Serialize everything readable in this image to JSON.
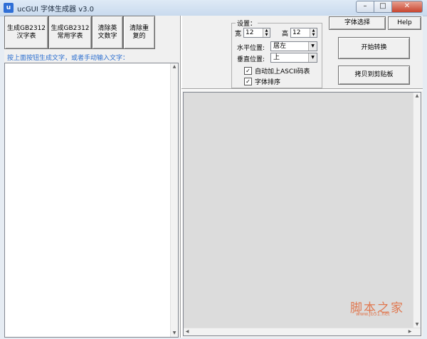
{
  "window": {
    "title": "ucGUI 字体生成器 v3.0",
    "icon": "app-icon",
    "controls": {
      "minimize": "–",
      "maximize": "□",
      "close": "✕"
    }
  },
  "left_panel": {
    "buttons": [
      "生成GB2312\n汉字表",
      "生成GB2312\n常用字表",
      "清除英\n文数字",
      "清除重\n复的"
    ],
    "hint": "按上面按钮生成文字，或者手动输入文字："
  },
  "settings": {
    "group_title": "设置：",
    "width_label": "宽",
    "width_value": "12",
    "height_label": "高",
    "height_value": "12",
    "h_align_label": "水平位置:",
    "h_align_value": "居左",
    "v_align_label": "垂直位置:",
    "v_align_value": "上",
    "auto_ascii_label": "自动加上ASCII码表",
    "auto_ascii_checked": true,
    "sort_label": "字体排序",
    "sort_checked": true
  },
  "right_buttons": {
    "font_select": "字体选择",
    "help": "Help",
    "start": "开始转换",
    "copy": "拷贝到剪贴板"
  },
  "watermark": {
    "text": "脚本之家",
    "url": "www.jb51.net"
  },
  "accent_color": "#2d6fcf"
}
